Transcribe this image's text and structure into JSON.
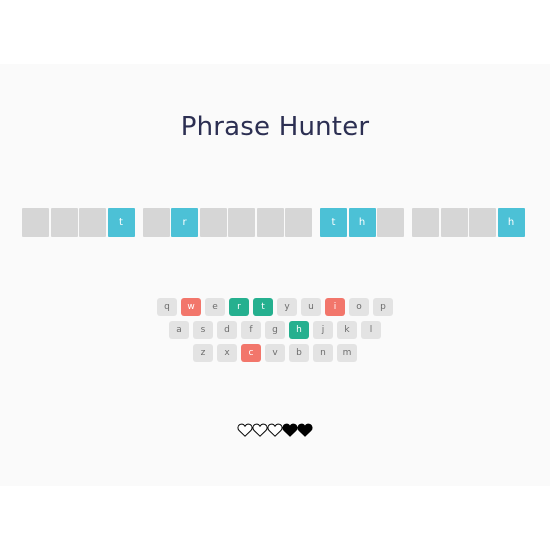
{
  "title": "Phrase Hunter",
  "phrase": {
    "words": [
      [
        {
          "letter": "",
          "shown": false
        },
        {
          "letter": "",
          "shown": false
        },
        {
          "letter": "",
          "shown": false
        },
        {
          "letter": "t",
          "shown": true
        }
      ],
      [
        {
          "letter": "",
          "shown": false
        },
        {
          "letter": "r",
          "shown": true
        },
        {
          "letter": "",
          "shown": false
        },
        {
          "letter": "",
          "shown": false
        },
        {
          "letter": "",
          "shown": false
        },
        {
          "letter": "",
          "shown": false
        }
      ],
      [
        {
          "letter": "t",
          "shown": true
        },
        {
          "letter": "h",
          "shown": true
        },
        {
          "letter": "",
          "shown": false
        }
      ],
      [
        {
          "letter": "",
          "shown": false
        },
        {
          "letter": "",
          "shown": false
        },
        {
          "letter": "",
          "shown": false
        },
        {
          "letter": "h",
          "shown": true
        }
      ]
    ]
  },
  "keyboard": {
    "rows": [
      [
        {
          "key": "q",
          "state": "unused"
        },
        {
          "key": "w",
          "state": "wrong"
        },
        {
          "key": "e",
          "state": "unused"
        },
        {
          "key": "r",
          "state": "chosen"
        },
        {
          "key": "t",
          "state": "chosen"
        },
        {
          "key": "y",
          "state": "unused"
        },
        {
          "key": "u",
          "state": "unused"
        },
        {
          "key": "i",
          "state": "wrong"
        },
        {
          "key": "o",
          "state": "unused"
        },
        {
          "key": "p",
          "state": "unused"
        }
      ],
      [
        {
          "key": "a",
          "state": "unused"
        },
        {
          "key": "s",
          "state": "unused"
        },
        {
          "key": "d",
          "state": "unused"
        },
        {
          "key": "f",
          "state": "unused"
        },
        {
          "key": "g",
          "state": "unused"
        },
        {
          "key": "h",
          "state": "chosen"
        },
        {
          "key": "j",
          "state": "unused"
        },
        {
          "key": "k",
          "state": "unused"
        },
        {
          "key": "l",
          "state": "unused"
        }
      ],
      [
        {
          "key": "z",
          "state": "unused"
        },
        {
          "key": "x",
          "state": "unused"
        },
        {
          "key": "c",
          "state": "wrong"
        },
        {
          "key": "v",
          "state": "unused"
        },
        {
          "key": "b",
          "state": "unused"
        },
        {
          "key": "n",
          "state": "unused"
        },
        {
          "key": "m",
          "state": "unused"
        }
      ]
    ]
  },
  "lives": {
    "hearts": [
      {
        "state": "lost",
        "icon": "heart-outline-icon"
      },
      {
        "state": "lost",
        "icon": "heart-outline-icon"
      },
      {
        "state": "lost",
        "icon": "heart-outline-icon"
      },
      {
        "state": "live",
        "icon": "heart-filled-icon"
      },
      {
        "state": "live",
        "icon": "heart-filled-icon"
      }
    ]
  },
  "colors": {
    "title": "#2c2f52",
    "hidden_tile": "#d6d6d6",
    "revealed_tile": "#4cc1d6",
    "key_default": "#e3e3e3",
    "key_chosen": "#25b08f",
    "key_wrong": "#f2766b"
  }
}
